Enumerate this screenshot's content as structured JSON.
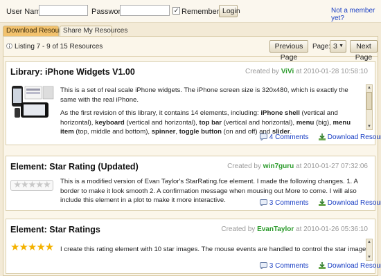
{
  "login": {
    "username_label": "User Name:",
    "password_label": "Password:",
    "username_value": "",
    "password_value": "",
    "remember_label": "Remember Me",
    "remember_checked": "✓",
    "login_button": "Login",
    "not_member_link": "Not a member yet?"
  },
  "tabs": [
    {
      "label": "Download Resources",
      "active": true
    },
    {
      "label": "Share My Resources",
      "active": false
    }
  ],
  "toolbar": {
    "listing_text": "Listing 7 - 9 of 15 Resources",
    "prev_button": "Previous Page",
    "page_label": "Page:",
    "page_value": "3",
    "next_button": "Next Page"
  },
  "resources": [
    {
      "title": "Library: iPhone Widgets V1.00",
      "created_by": "Created by",
      "author": "ViVi",
      "at": "at 2010-01-28 10:58:10",
      "desc1": "This is a set of real scale iPhone widgets. The iPhone screen size is 320x480, which is exactly the same with the real iPhone.",
      "desc2_prefix": "As the first revision of this library, it contains 14 elements, including:",
      "desc2_items": [
        {
          "b": "iPhone shell",
          "t": " (vertical and horizontal), "
        },
        {
          "b": "keyboard",
          "t": " (vertical and horizontal), "
        },
        {
          "b": "top bar",
          "t": " (vertical and horizontal), "
        },
        {
          "b": "menu",
          "t": " (big), "
        },
        {
          "b": "menu item",
          "t": " (top, middle and bottom), "
        },
        {
          "b": "spinner",
          "t": ", "
        },
        {
          "b": "toggle button",
          "t": " (on and off) and "
        },
        {
          "b": "slider",
          "t": "."
        }
      ],
      "comments": "4 Comments",
      "download": "Download Resource"
    },
    {
      "title": "Element: Star Rating (Updated)",
      "created_by": "Created by",
      "author": "win7guru",
      "at": "at 2010-01-27 07:32:06",
      "desc1": "This is a modified version of Evan Taylor's StarRating.fce element. I made the following changes. 1. A border to make it look smooth 2. A confirmation message when mousing out More to come. I will also include this element in a plot to make it more interactive.",
      "comments": "3 Comments",
      "download": "Download Resource"
    },
    {
      "title": "Element: Star Ratings",
      "created_by": "Created by",
      "author": "EvanTaylor",
      "at": "at 2010-01-26 05:36:10",
      "desc1": "I create this rating element with 10 star images. The mouse events are handled to control the star image show / hide. All stuffs are",
      "comments": "3 Comments",
      "download": "Download Resource"
    }
  ],
  "colors": {
    "link": "#1a3fc4",
    "author": "#2a9a2a",
    "tab_active": "#f2c26e",
    "star": "#f4b200"
  },
  "icons": {
    "info": "info-icon",
    "comment": "comment-icon",
    "download": "download-icon",
    "dropdown": "chevron-down-icon"
  }
}
